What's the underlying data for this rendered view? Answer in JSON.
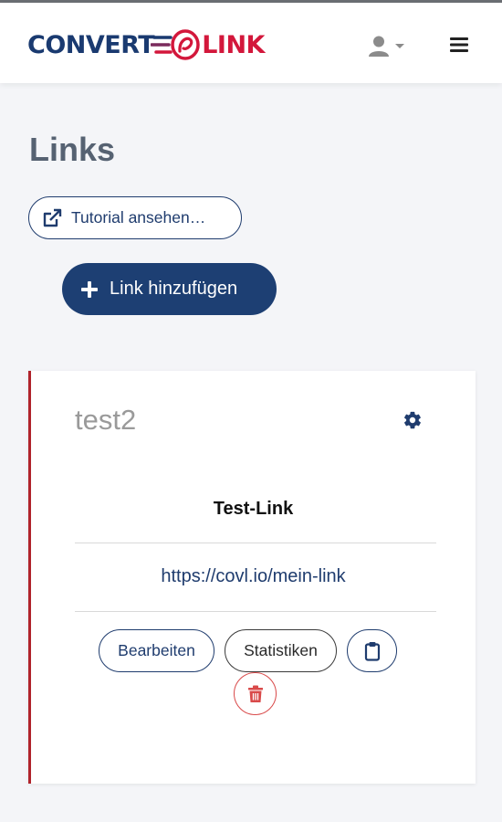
{
  "header": {
    "logo_left": "CONVERT",
    "logo_right": "LINK",
    "brand_colors": {
      "navy": "#1a3a70",
      "red": "#d3173b"
    },
    "icons": {
      "user": "user-icon",
      "caret": "caret-down-icon",
      "menu": "hamburger-menu-icon"
    }
  },
  "main": {
    "title": "Links",
    "tutorial_label": "Tutorial ansehen…",
    "add_label": "Link hinzufügen"
  },
  "card": {
    "title": "test2",
    "link_name": "Test-Link",
    "link_url": "https://covl.io/mein-link",
    "edit_label": "Bearbeiten",
    "stats_label": "Statistiken",
    "accent_color": "#b0232b",
    "icons": {
      "settings": "gear-icon",
      "copy": "clipboard-icon",
      "delete": "trash-icon"
    }
  }
}
